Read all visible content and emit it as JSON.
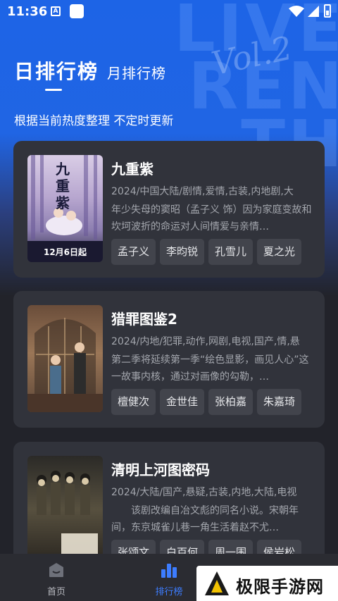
{
  "status_bar": {
    "time": "11:36",
    "notification_icon_letter": "A"
  },
  "header": {
    "tab_day": "日排行榜",
    "tab_month": "月排行榜",
    "subtitle": "根据当前热度整理 不定时更新"
  },
  "cards": [
    {
      "title": "九重紫",
      "meta": "2024/中国大陆/剧情,爱情,古装,内地剧,大",
      "desc": "年少失母的窦昭（孟子义 饰）因为家庭变故和坎坷波折的命运对人间情爱与亲情…",
      "tags": [
        "孟子义",
        "李昀锐",
        "孔雪儿",
        "夏之光"
      ],
      "poster_text": "九重紫",
      "poster_date": "12月6日起"
    },
    {
      "title": "猎罪图鉴2",
      "meta": "2024/内地/犯罪,动作,网剧,电视,国产,情,悬",
      "desc": "第二季将延续第一季“绘色显影，画见人心”这一故事内核，通过对画像的勾勒，…",
      "tags": [
        "檀健次",
        "金世佳",
        "张柏嘉",
        "朱嘉琦"
      ]
    },
    {
      "title": "清明上河图密码",
      "meta": "2024/大陆/国产,悬疑,古装,内地,大陆,电视",
      "desc": "　　该剧改编自冶文彪的同名小说。宋朝年间，东京城雀儿巷一角生活着赵不尤…",
      "tags": [
        "张颂文",
        "白百何",
        "周一围",
        "侯岩松"
      ]
    }
  ],
  "bottom_nav": {
    "items": [
      {
        "label": "首页",
        "icon": "home-icon"
      },
      {
        "label": "排行榜",
        "icon": "ranking-icon",
        "active": true
      }
    ]
  },
  "watermark": {
    "text": "极限手游网"
  },
  "colors": {
    "accent": "#3d7dff",
    "card_bg": "#31333b",
    "page_bg": "#22232a",
    "hero_blue": "#1d64e6"
  }
}
